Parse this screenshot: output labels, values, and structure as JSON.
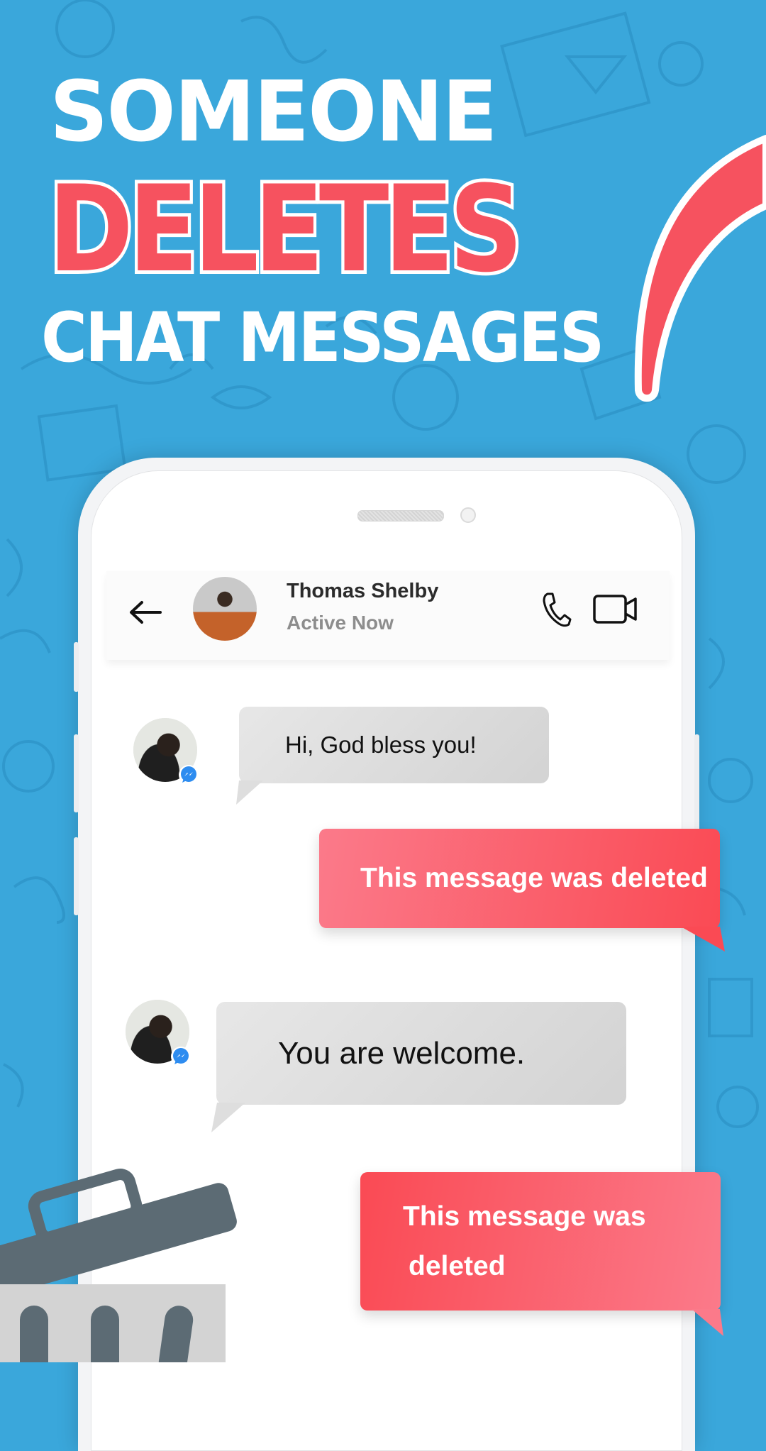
{
  "headline": {
    "line1": "SOMEONE",
    "line2": "DELETES",
    "line3": "CHAT MESSAGES"
  },
  "colors": {
    "background": "#3aa7db",
    "accent_red": "#f6525f",
    "incoming_bubble": "#dcdcdc",
    "outgoing_bubble_start": "#fb7a8a",
    "outgoing_bubble_end": "#fa4a54",
    "messenger_blue": "#2d8cf0"
  },
  "chat_header": {
    "back_icon": "arrow-left-icon",
    "contact_name": "Thomas Shelby",
    "status": "Active Now",
    "call_icon": "phone-icon",
    "video_icon": "video-camera-icon"
  },
  "messages": [
    {
      "direction": "incoming",
      "text": "Hi, God bless you!",
      "avatar_badge": "messenger-icon"
    },
    {
      "direction": "outgoing",
      "text": "This message was deleted"
    },
    {
      "direction": "incoming",
      "text": "You are welcome.",
      "avatar_badge": "messenger-icon"
    },
    {
      "direction": "outgoing",
      "text_line1": "This message was",
      "text_line2": "deleted"
    }
  ],
  "decorations": {
    "trash": "trash-can-icon",
    "swoosh": "red-swoosh"
  }
}
